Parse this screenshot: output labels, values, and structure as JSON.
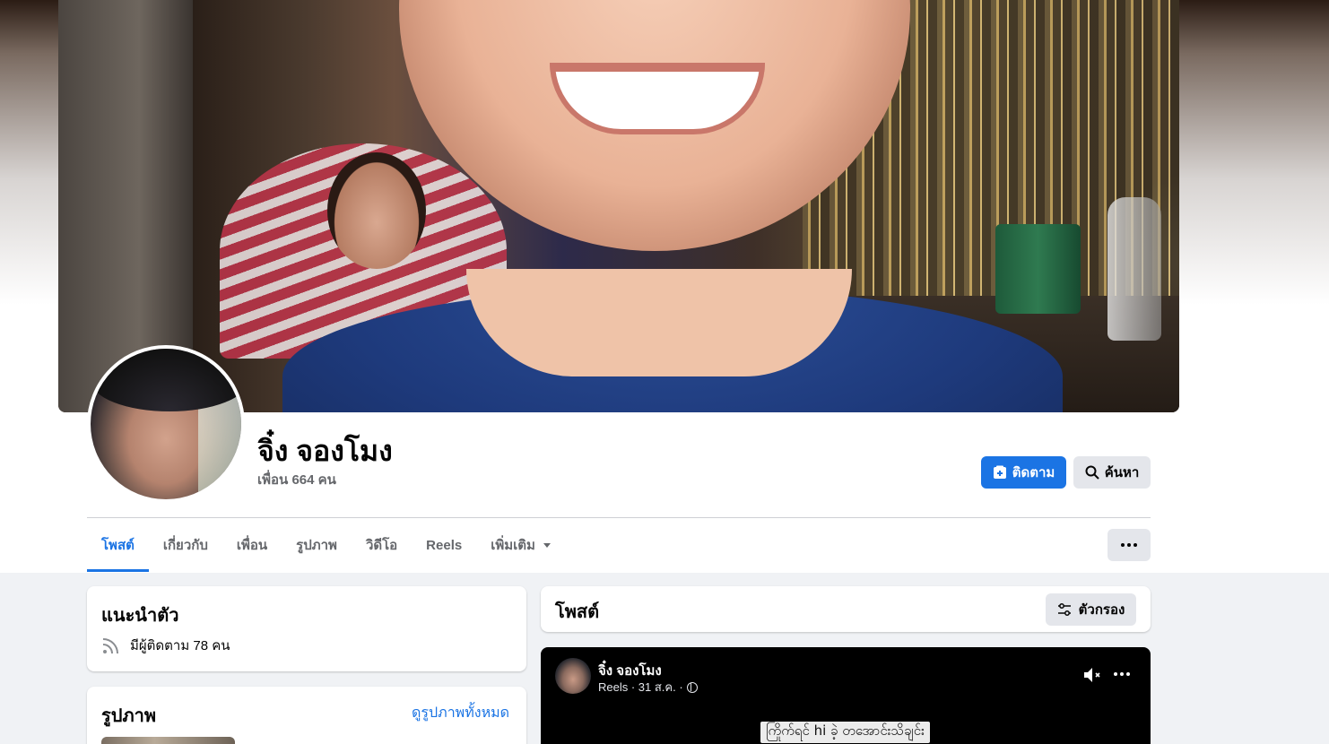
{
  "profile": {
    "name": "จิ๋ง จองโมง",
    "friends": "เพื่อน 664 คน"
  },
  "actions": {
    "follow_label": "ติดตาม",
    "search_label": "ค้นหา"
  },
  "tabs": [
    {
      "label": "โพสต์",
      "active": true
    },
    {
      "label": "เกี่ยวกับ"
    },
    {
      "label": "เพื่อน"
    },
    {
      "label": "รูปภาพ"
    },
    {
      "label": "วิดีโอ"
    },
    {
      "label": "Reels"
    },
    {
      "label": "เพิ่มเติม"
    }
  ],
  "intro": {
    "title": "แนะนำตัว",
    "followers": "มีผู้ติดตาม 78 คน"
  },
  "photos": {
    "title": "รูปภาพ",
    "see_all": "ดูรูปภาพทั้งหมด"
  },
  "posts": {
    "title": "โพสต์",
    "filter_label": "ตัวกรอง"
  },
  "reel_post": {
    "author": "จิ๋ง จองโมง",
    "meta": "Reels · 31 ส.ค. ·",
    "caption": "ကြိုက်ရင် hi ခဲ့ တအောင်းသိချင်း"
  },
  "colors": {
    "accent": "#1b74e4",
    "background": "#f0f2f5",
    "secondary_button": "#e4e6eb"
  }
}
